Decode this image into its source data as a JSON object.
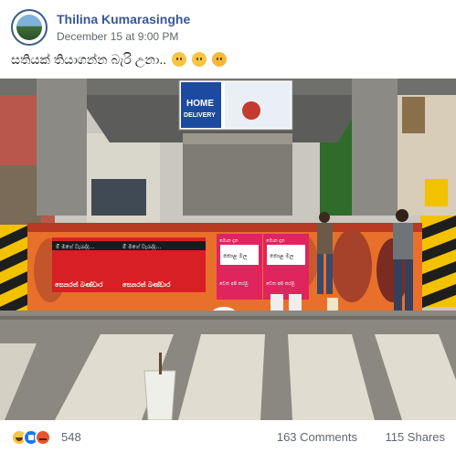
{
  "post": {
    "author": "Thilina Kumarasinghe",
    "timestamp": "December 15 at 9:00 PM",
    "text": "සතියක් තියාගන්න බැරි උනා..",
    "text_emojis": [
      "disappointed-face-icon",
      "disappointed-face-icon",
      "crying-face-icon"
    ]
  },
  "photo": {
    "billboard": {
      "line1": "HOME",
      "line2": "DELIVERY"
    },
    "poster_left": {
      "line1": "ම් මගේ වැරැද්ද...",
      "line2": "සෙනරත් බණ්ඩාර"
    },
    "poster_mid": {
      "line1": "ම් මගේ වැරැද්ද...",
      "line2": "සෙනරත් බණ්ඩාර"
    },
    "poster_green1": {
      "line1": "මොන දෑත",
      "line2": "කොළ මල",
      "line3": "වෙත අපි කරමු"
    },
    "poster_green2": {
      "line1": "මොන දෑත",
      "line2": "කොළ මල",
      "line3": "වෙත අපි කරමු"
    }
  },
  "footer": {
    "reactions": [
      "haha-icon",
      "like-icon",
      "angry-icon"
    ],
    "reaction_count": "548",
    "comments": "163 Comments",
    "shares": "115 Shares"
  },
  "colors": {
    "author": "#385898",
    "meta": "#606770",
    "poster_red": "#d81f26",
    "mural_orange": "#e8702a",
    "barrier_yellow": "#f2c200"
  }
}
